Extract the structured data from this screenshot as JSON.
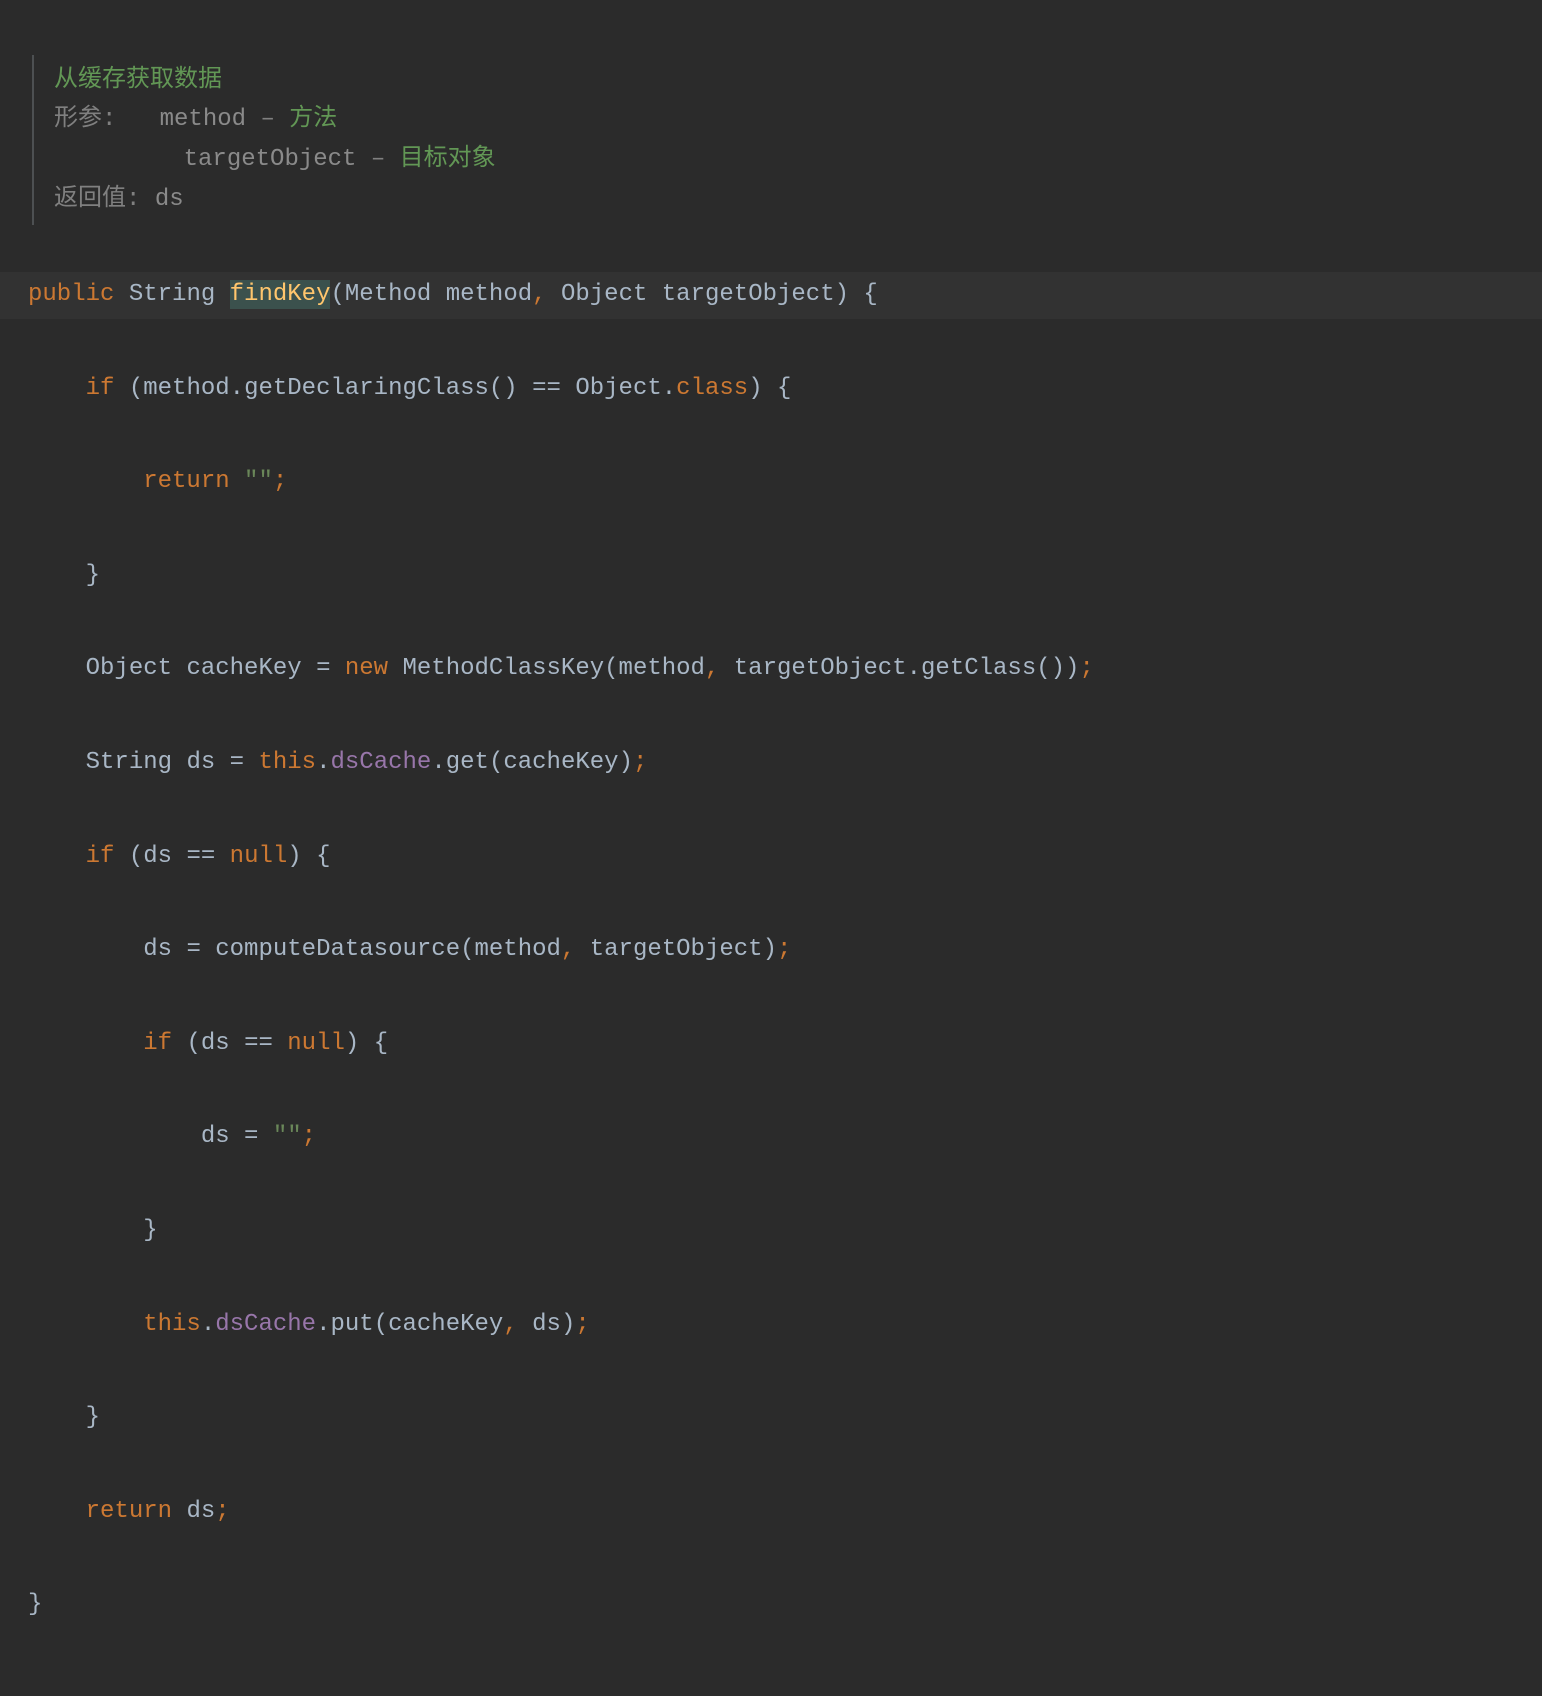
{
  "javadoc": {
    "description": "从缓存获取数据",
    "params_label": "形参:",
    "param1_name": "method",
    "param1_sep": " – ",
    "param1_desc": "方法",
    "param2_name": "targetObject",
    "param2_sep": " – ",
    "param2_desc": "目标对象",
    "returns_label": "返回值:",
    "returns_value": "ds"
  },
  "code": {
    "l1_public": "public",
    "l1_return_type": "String",
    "l1_method_name": "findKey",
    "l1_p1_type": "Method",
    "l1_p1_name": "method",
    "l1_p2_type": "Object",
    "l1_p2_name": "targetObject",
    "l2_if": "if",
    "l2_method": "method",
    "l2_get_declaring": "getDeclaringClass",
    "l2_eq": "==",
    "l2_object": "Object",
    "l2_class": "class",
    "l3_return": "return",
    "l3_str": "\"\"",
    "l5_obj_type": "Object",
    "l5_cache_key": "cacheKey",
    "l5_new": "new",
    "l5_mck": "MethodClassKey",
    "l5_method": "method",
    "l5_target": "targetObject",
    "l5_getclass": "getClass",
    "l6_string": "String",
    "l6_ds": "ds",
    "l6_this": "this",
    "l6_dscache": "dsCache",
    "l6_get": "get",
    "l6_cachekey": "cacheKey",
    "l7_if": "if",
    "l7_ds": "ds",
    "l7_eq": "==",
    "l7_null": "null",
    "l8_ds": "ds",
    "l8_compute": "computeDatasource",
    "l8_method": "method",
    "l8_target": "targetObject",
    "l9_if": "if",
    "l9_ds": "ds",
    "l9_eq": "==",
    "l9_null": "null",
    "l10_ds": "ds",
    "l10_str": "\"\"",
    "l12_this": "this",
    "l12_dscache": "dsCache",
    "l12_put": "put",
    "l12_cachekey": "cacheKey",
    "l12_ds": "ds",
    "l14_return": "return",
    "l14_ds": "ds"
  }
}
